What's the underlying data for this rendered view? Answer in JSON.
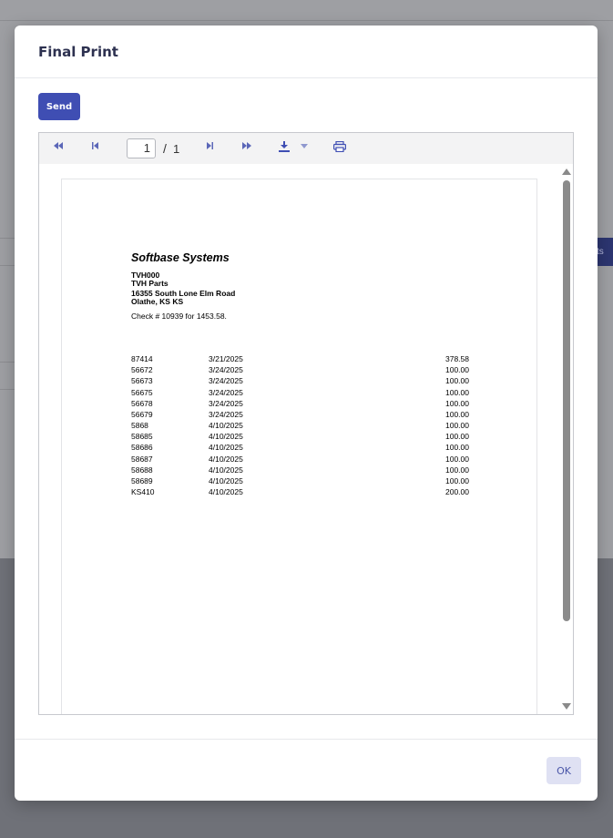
{
  "background": {
    "partial_button_label": "ts"
  },
  "modal": {
    "title": "Final Print",
    "send_label": "Send",
    "ok_label": "OK"
  },
  "viewer": {
    "toolbar": {
      "first_page_icon": "first-page-icon",
      "previous_page_icon": "previous-page-icon",
      "next_page_icon": "next-page-icon",
      "last_page_icon": "last-page-icon",
      "download_icon": "download-icon",
      "download_menu_icon": "caret-down-icon",
      "print_icon": "print-icon",
      "current_page": "1",
      "page_separator": "/",
      "total_pages": "1"
    },
    "document": {
      "company": "Softbase Systems",
      "address_lines": [
        "TVH000",
        "TVH Parts",
        "16355 South Lone Elm Road",
        "Olathe, KS KS"
      ],
      "check_line": "Check # 10939 for 1453.58.",
      "rows": [
        {
          "invoice": "87414",
          "date": "3/21/2025",
          "amount": "378.58"
        },
        {
          "invoice": "56672",
          "date": "3/24/2025",
          "amount": "100.00"
        },
        {
          "invoice": "56673",
          "date": "3/24/2025",
          "amount": "100.00"
        },
        {
          "invoice": "56675",
          "date": "3/24/2025",
          "amount": "100.00"
        },
        {
          "invoice": "56678",
          "date": "3/24/2025",
          "amount": "100.00"
        },
        {
          "invoice": "56679",
          "date": "3/24/2025",
          "amount": "100.00"
        },
        {
          "invoice": "5868",
          "date": "4/10/2025",
          "amount": "100.00"
        },
        {
          "invoice": "58685",
          "date": "4/10/2025",
          "amount": "100.00"
        },
        {
          "invoice": "58686",
          "date": "4/10/2025",
          "amount": "100.00"
        },
        {
          "invoice": "58687",
          "date": "4/10/2025",
          "amount": "100.00"
        },
        {
          "invoice": "58688",
          "date": "4/10/2025",
          "amount": "100.00"
        },
        {
          "invoice": "58689",
          "date": "4/10/2025",
          "amount": "100.00"
        },
        {
          "invoice": "KS410",
          "date": "4/10/2025",
          "amount": "200.00"
        }
      ]
    }
  },
  "colors": {
    "primary": "#3f4eb3",
    "ok_button_bg": "#dfe1f3",
    "toolbar_icon": "#5b67b8",
    "overlay_top": "#9e9fa3",
    "overlay_bottom": "#6f7178"
  }
}
